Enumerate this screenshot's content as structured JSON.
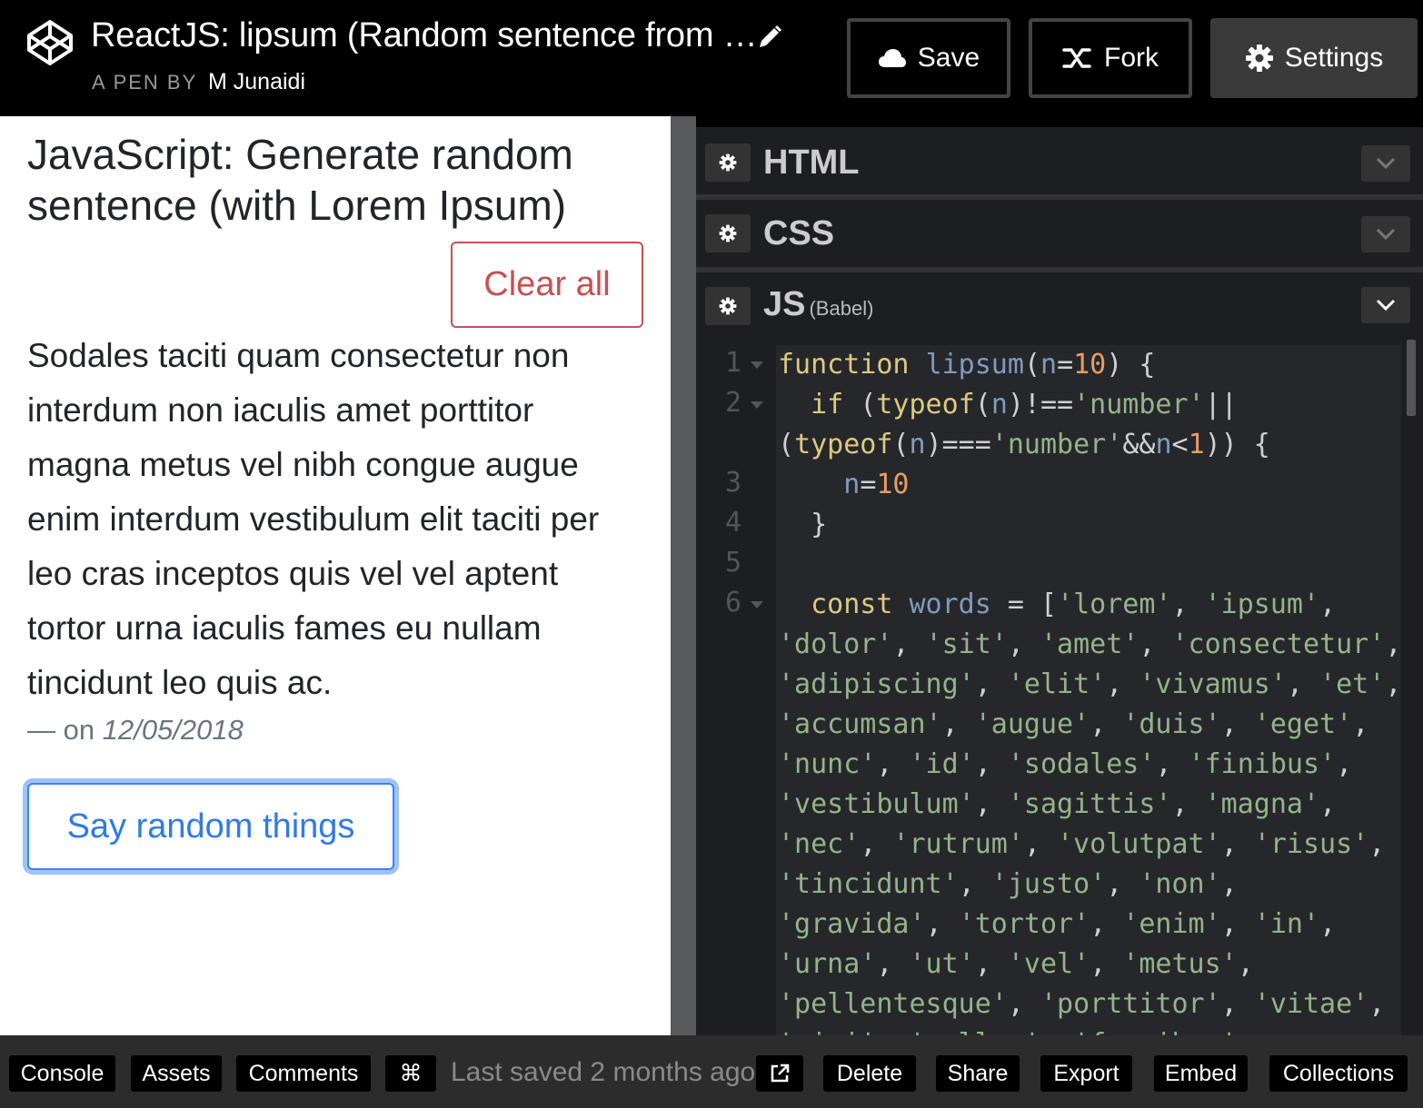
{
  "header": {
    "title": "ReactJS: lipsum (Random sentence from …",
    "byline_prefix": "A PEN BY",
    "author": "M Junaidi",
    "save_label": "Save",
    "fork_label": "Fork",
    "settings_label": "Settings"
  },
  "preview": {
    "heading": "JavaScript: Generate random sentence (with Lorem Ipsum)",
    "clear_all_label": "Clear all",
    "quote": "Sodales taciti quam consectetur non interdum non iaculis amet porttitor magna metus vel nibh congue augue enim interdum vestibulum elit taciti per leo cras inceptos quis vel vel aptent tortor urna iaculis fames eu nullam tincidunt leo quis ac.",
    "meta_prefix": "— on ",
    "date": "12/05/2018",
    "say_random_label": "Say random things"
  },
  "editor": {
    "html_title": "HTML",
    "css_title": "CSS",
    "js_title": "JS",
    "js_sub": "(Babel)",
    "line_numbers": [
      "1",
      "2",
      "3",
      "4",
      "5",
      "6"
    ]
  },
  "footer": {
    "console_label": "Console",
    "assets_label": "Assets",
    "comments_label": "Comments",
    "keys_label": "⌘",
    "last_saved": "Last saved 2 months ago",
    "delete_label": "Delete",
    "share_label": "Share",
    "export_label": "Export",
    "embed_label": "Embed",
    "collections_label": "Collections"
  },
  "colors": {
    "clear_all": "#c94f50",
    "say_random": "#2f7be6",
    "editor_bg": "#1d1e22",
    "keyword": "#ddca7e",
    "string": "#96b38a",
    "number": "#e89d63"
  },
  "icons": [
    "codepen-logo-icon",
    "pencil-icon",
    "cloud-icon",
    "fork-icon",
    "gear-icon",
    "chevron-down-icon",
    "external-link-icon"
  ]
}
